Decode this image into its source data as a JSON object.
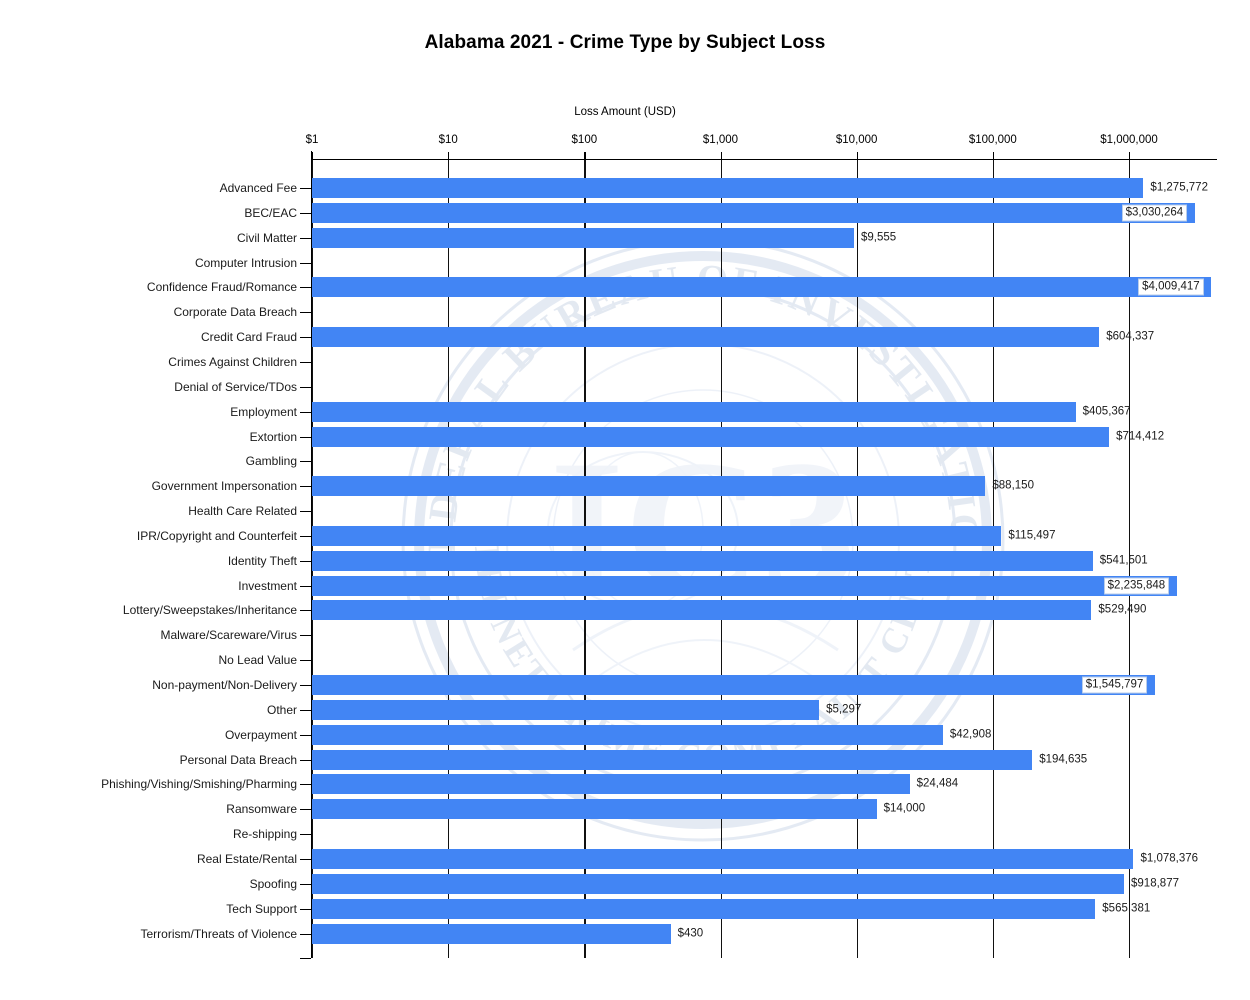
{
  "chart_data": {
    "type": "bar",
    "orientation": "horizontal",
    "title": "Alabama 2021 - Crime Type by Subject Loss",
    "xlabel": "Loss Amount (USD)",
    "ylabel": "",
    "xscale": "log",
    "xlim": [
      1,
      1000000
    ],
    "xtick_labels": [
      "$1",
      "$10",
      "$100",
      "$1,000",
      "$10,000",
      "$100,000",
      "$1,000,000"
    ],
    "xtick_values": [
      1,
      10,
      100,
      1000,
      10000,
      100000,
      1000000
    ],
    "grid": true,
    "legend": false,
    "bar_color": "#4285f4",
    "categories": [
      "Advanced Fee",
      "BEC/EAC",
      "Civil Matter",
      "Computer Intrusion",
      "Confidence Fraud/Romance",
      "Corporate Data Breach",
      "Credit Card Fraud",
      "Crimes Against Children",
      "Denial of Service/TDos",
      "Employment",
      "Extortion",
      "Gambling",
      "Government Impersonation",
      "Health Care Related",
      "IPR/Copyright and Counterfeit",
      "Identity Theft",
      "Investment",
      "Lottery/Sweepstakes/Inheritance",
      "Malware/Scareware/Virus",
      "No Lead Value",
      "Non-payment/Non-Delivery",
      "Other",
      "Overpayment",
      "Personal Data Breach",
      "Phishing/Vishing/Smishing/Pharming",
      "Ransomware",
      "Re-shipping",
      "Real Estate/Rental",
      "Spoofing",
      "Tech Support",
      "Terrorism/Threats of Violence"
    ],
    "values": [
      1275772,
      3030264,
      9555,
      0,
      4009417,
      0,
      604337,
      0,
      0,
      405367,
      714412,
      0,
      88150,
      0,
      115497,
      541501,
      2235848,
      529490,
      0,
      0,
      1545797,
      5297,
      42908,
      194635,
      24484,
      14000,
      0,
      1078376,
      918877,
      565381,
      430
    ],
    "value_labels": [
      "$1,275,772",
      "$3,030,264",
      "$9,555",
      "",
      "$4,009,417",
      "",
      "$604,337",
      "",
      "",
      "$405,367",
      "$714,412",
      "",
      "$88,150",
      "",
      "$115,497",
      "$541,501",
      "$2,235,848",
      "$529,490",
      "",
      "",
      "$1,545,797",
      "$5,297",
      "$42,908",
      "$194,635",
      "$24,484",
      "$14,000",
      "",
      "$1,078,376",
      "$918,877",
      "$565,381",
      "$430"
    ]
  },
  "watermark": {
    "outer_top_text": "FEDERAL BUREAU OF INVESTIGATION",
    "outer_bottom_text": "INTERNET CRIME COMPLAINT CENTER",
    "center_text": "IC3"
  }
}
